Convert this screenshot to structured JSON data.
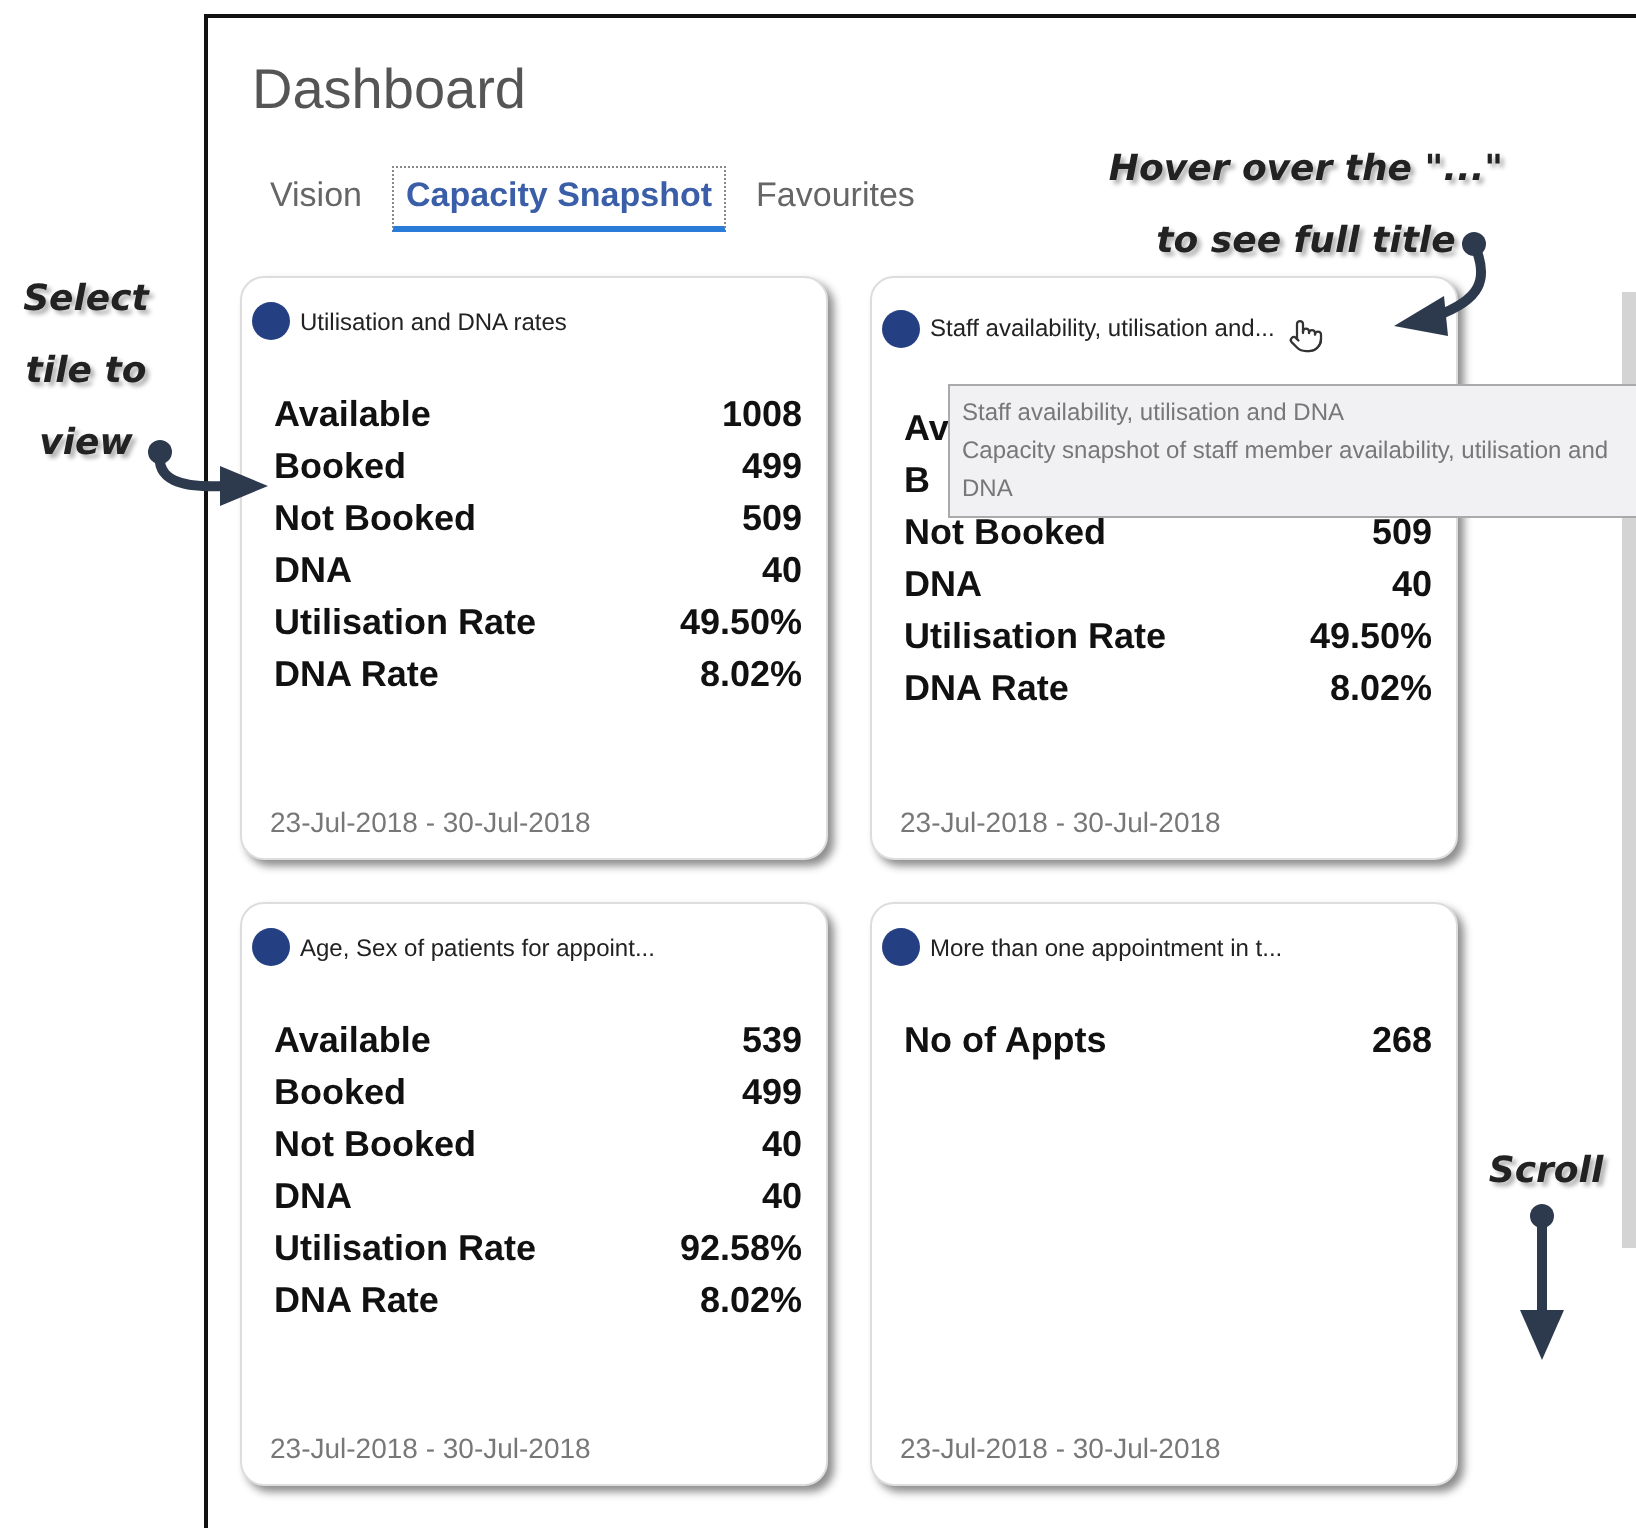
{
  "title": "Dashboard",
  "tabs": [
    {
      "label": "Vision",
      "selected": false
    },
    {
      "label": "Capacity Snapshot",
      "selected": true
    },
    {
      "label": "Favourites",
      "selected": false
    }
  ],
  "tiles": [
    {
      "title": "Utilisation and DNA rates",
      "color": "#243f82",
      "rows": [
        {
          "label": "Available",
          "value": "1008"
        },
        {
          "label": "Booked",
          "value": "499"
        },
        {
          "label": "Not Booked",
          "value": "509"
        },
        {
          "label": "DNA",
          "value": "40"
        },
        {
          "label": "Utilisation Rate",
          "value": "49.50%"
        },
        {
          "label": "DNA Rate",
          "value": "8.02%"
        }
      ],
      "date": "23-Jul-2018 - 30-Jul-2018",
      "hovered": false
    },
    {
      "title": "Staff availability, utilisation and...",
      "color": "#243f82",
      "rows": [
        {
          "label": "Av"
        },
        {
          "label": "B"
        },
        {
          "label": "Not Booked",
          "value": "509"
        },
        {
          "label": "DNA",
          "value": "40"
        },
        {
          "label": "Utilisation Rate",
          "value": "49.50%"
        },
        {
          "label": "DNA Rate",
          "value": "8.02%"
        }
      ],
      "date": "23-Jul-2018 - 30-Jul-2018",
      "hovered": true
    },
    {
      "title": "Age, Sex of patients for appoint...",
      "color": "#243f82",
      "rows": [
        {
          "label": "Available",
          "value": "539"
        },
        {
          "label": "Booked",
          "value": "499"
        },
        {
          "label": "Not Booked",
          "value": "40"
        },
        {
          "label": "DNA",
          "value": "40"
        },
        {
          "label": "Utilisation Rate",
          "value": "92.58%"
        },
        {
          "label": "DNA Rate",
          "value": "8.02%"
        }
      ],
      "date": "23-Jul-2018 - 30-Jul-2018",
      "hovered": false
    },
    {
      "title": "More than one appointment in t...",
      "color": "#243f82",
      "rows": [
        {
          "label": "No of Appts",
          "value": "268"
        }
      ],
      "date": "23-Jul-2018 - 30-Jul-2018",
      "hovered": false
    }
  ],
  "tooltip": {
    "title": "Staff availability, utilisation and DNA",
    "description": "Capacity snapshot of staff member availability, utilisation and DNA"
  },
  "annotations": [
    {
      "text": "Select tile to view"
    },
    {
      "text": "Hover over the \"...\" to see full title"
    },
    {
      "text": "Scroll"
    }
  ]
}
